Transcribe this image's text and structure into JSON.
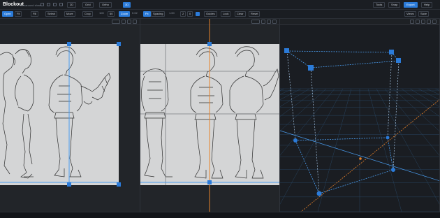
{
  "app": {
    "name": "Blockout",
    "subtitle": "Turnaround sheet"
  },
  "topbar": {
    "tabs": [
      {
        "label": "2D",
        "active": false
      },
      {
        "label": "Grid",
        "active": false
      },
      {
        "label": "Ortho",
        "active": false
      },
      {
        "label": "3D",
        "active": true
      }
    ],
    "right_buttons": [
      {
        "label": "Tools",
        "active": false
      },
      {
        "label": "Snap",
        "active": false
      },
      {
        "label": "Export",
        "active": true
      },
      {
        "label": "Help",
        "active": false
      },
      {
        "label": "Views",
        "active": false
      },
      {
        "label": "Save",
        "active": false
      }
    ]
  },
  "toolbar": {
    "items": [
      {
        "label": "Open",
        "style": "blue"
      },
      {
        "label": "Fit",
        "style": "outline"
      },
      {
        "label": "Fill",
        "style": "outline"
      },
      {
        "label": "Select",
        "style": "outline"
      },
      {
        "label": "Move",
        "style": "outline"
      },
      {
        "label": "Crop",
        "style": "outline"
      },
      {
        "label": "100",
        "style": "txt"
      },
      {
        "label": "60",
        "style": "outline"
      },
      {
        "label": "Zoom",
        "style": "blue"
      },
      {
        "label": "0.02",
        "style": "txt"
      },
      {
        "label": "Px",
        "style": "blue"
      },
      {
        "label": "Spacing",
        "style": "outline"
      },
      {
        "label": "1.00",
        "style": "txt"
      },
      {
        "label": "2",
        "style": "outline"
      },
      {
        "label": "0",
        "style": "outline"
      },
      {
        "label": "",
        "style": "chk"
      },
      {
        "label": "Guides",
        "style": "outline"
      },
      {
        "label": "Lock",
        "style": "outline"
      },
      {
        "label": "Clear",
        "style": "outline"
      },
      {
        "label": "Reset",
        "style": "outline"
      }
    ]
  },
  "panels": {
    "left": {
      "label": "",
      "footer": ""
    },
    "middle": {
      "label": "",
      "footer": ""
    },
    "right": {
      "label": "",
      "footer": ""
    }
  },
  "statusbar": {
    "text": ""
  },
  "colors": {
    "accent": "#2b7bd9",
    "guide_orange": "#e8822a",
    "guide_blue": "#4a9df0",
    "paper": "#d4d5d6",
    "grid3d": "#2a4a6a"
  }
}
